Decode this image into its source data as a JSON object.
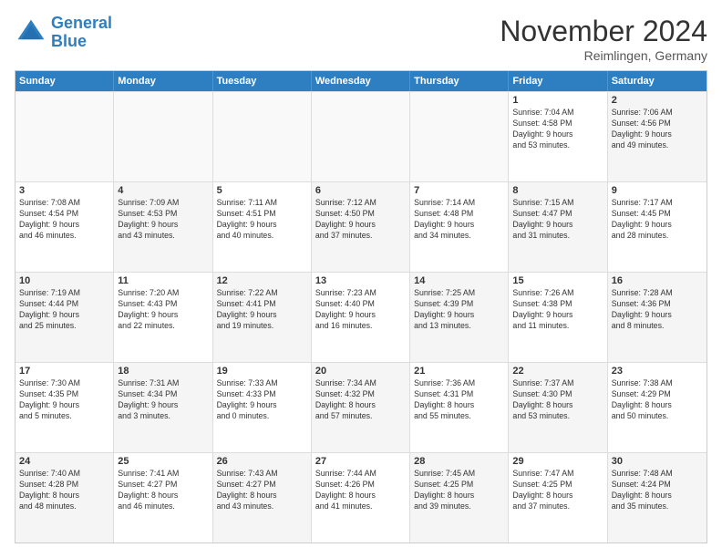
{
  "header": {
    "logo_general": "General",
    "logo_blue": "Blue",
    "month_title": "November 2024",
    "location": "Reimlingen, Germany"
  },
  "weekdays": [
    "Sunday",
    "Monday",
    "Tuesday",
    "Wednesday",
    "Thursday",
    "Friday",
    "Saturday"
  ],
  "weeks": [
    [
      {
        "day": "",
        "info": "",
        "empty": true
      },
      {
        "day": "",
        "info": "",
        "empty": true
      },
      {
        "day": "",
        "info": "",
        "empty": true
      },
      {
        "day": "",
        "info": "",
        "empty": true
      },
      {
        "day": "",
        "info": "",
        "empty": true
      },
      {
        "day": "1",
        "info": "Sunrise: 7:04 AM\nSunset: 4:58 PM\nDaylight: 9 hours\nand 53 minutes.",
        "empty": false
      },
      {
        "day": "2",
        "info": "Sunrise: 7:06 AM\nSunset: 4:56 PM\nDaylight: 9 hours\nand 49 minutes.",
        "empty": false,
        "shaded": true
      }
    ],
    [
      {
        "day": "3",
        "info": "Sunrise: 7:08 AM\nSunset: 4:54 PM\nDaylight: 9 hours\nand 46 minutes.",
        "empty": false
      },
      {
        "day": "4",
        "info": "Sunrise: 7:09 AM\nSunset: 4:53 PM\nDaylight: 9 hours\nand 43 minutes.",
        "empty": false,
        "shaded": true
      },
      {
        "day": "5",
        "info": "Sunrise: 7:11 AM\nSunset: 4:51 PM\nDaylight: 9 hours\nand 40 minutes.",
        "empty": false
      },
      {
        "day": "6",
        "info": "Sunrise: 7:12 AM\nSunset: 4:50 PM\nDaylight: 9 hours\nand 37 minutes.",
        "empty": false,
        "shaded": true
      },
      {
        "day": "7",
        "info": "Sunrise: 7:14 AM\nSunset: 4:48 PM\nDaylight: 9 hours\nand 34 minutes.",
        "empty": false
      },
      {
        "day": "8",
        "info": "Sunrise: 7:15 AM\nSunset: 4:47 PM\nDaylight: 9 hours\nand 31 minutes.",
        "empty": false,
        "shaded": true
      },
      {
        "day": "9",
        "info": "Sunrise: 7:17 AM\nSunset: 4:45 PM\nDaylight: 9 hours\nand 28 minutes.",
        "empty": false
      }
    ],
    [
      {
        "day": "10",
        "info": "Sunrise: 7:19 AM\nSunset: 4:44 PM\nDaylight: 9 hours\nand 25 minutes.",
        "empty": false,
        "shaded": true
      },
      {
        "day": "11",
        "info": "Sunrise: 7:20 AM\nSunset: 4:43 PM\nDaylight: 9 hours\nand 22 minutes.",
        "empty": false
      },
      {
        "day": "12",
        "info": "Sunrise: 7:22 AM\nSunset: 4:41 PM\nDaylight: 9 hours\nand 19 minutes.",
        "empty": false,
        "shaded": true
      },
      {
        "day": "13",
        "info": "Sunrise: 7:23 AM\nSunset: 4:40 PM\nDaylight: 9 hours\nand 16 minutes.",
        "empty": false
      },
      {
        "day": "14",
        "info": "Sunrise: 7:25 AM\nSunset: 4:39 PM\nDaylight: 9 hours\nand 13 minutes.",
        "empty": false,
        "shaded": true
      },
      {
        "day": "15",
        "info": "Sunrise: 7:26 AM\nSunset: 4:38 PM\nDaylight: 9 hours\nand 11 minutes.",
        "empty": false
      },
      {
        "day": "16",
        "info": "Sunrise: 7:28 AM\nSunset: 4:36 PM\nDaylight: 9 hours\nand 8 minutes.",
        "empty": false,
        "shaded": true
      }
    ],
    [
      {
        "day": "17",
        "info": "Sunrise: 7:30 AM\nSunset: 4:35 PM\nDaylight: 9 hours\nand 5 minutes.",
        "empty": false
      },
      {
        "day": "18",
        "info": "Sunrise: 7:31 AM\nSunset: 4:34 PM\nDaylight: 9 hours\nand 3 minutes.",
        "empty": false,
        "shaded": true
      },
      {
        "day": "19",
        "info": "Sunrise: 7:33 AM\nSunset: 4:33 PM\nDaylight: 9 hours\nand 0 minutes.",
        "empty": false
      },
      {
        "day": "20",
        "info": "Sunrise: 7:34 AM\nSunset: 4:32 PM\nDaylight: 8 hours\nand 57 minutes.",
        "empty": false,
        "shaded": true
      },
      {
        "day": "21",
        "info": "Sunrise: 7:36 AM\nSunset: 4:31 PM\nDaylight: 8 hours\nand 55 minutes.",
        "empty": false
      },
      {
        "day": "22",
        "info": "Sunrise: 7:37 AM\nSunset: 4:30 PM\nDaylight: 8 hours\nand 53 minutes.",
        "empty": false,
        "shaded": true
      },
      {
        "day": "23",
        "info": "Sunrise: 7:38 AM\nSunset: 4:29 PM\nDaylight: 8 hours\nand 50 minutes.",
        "empty": false
      }
    ],
    [
      {
        "day": "24",
        "info": "Sunrise: 7:40 AM\nSunset: 4:28 PM\nDaylight: 8 hours\nand 48 minutes.",
        "empty": false,
        "shaded": true
      },
      {
        "day": "25",
        "info": "Sunrise: 7:41 AM\nSunset: 4:27 PM\nDaylight: 8 hours\nand 46 minutes.",
        "empty": false
      },
      {
        "day": "26",
        "info": "Sunrise: 7:43 AM\nSunset: 4:27 PM\nDaylight: 8 hours\nand 43 minutes.",
        "empty": false,
        "shaded": true
      },
      {
        "day": "27",
        "info": "Sunrise: 7:44 AM\nSunset: 4:26 PM\nDaylight: 8 hours\nand 41 minutes.",
        "empty": false
      },
      {
        "day": "28",
        "info": "Sunrise: 7:45 AM\nSunset: 4:25 PM\nDaylight: 8 hours\nand 39 minutes.",
        "empty": false,
        "shaded": true
      },
      {
        "day": "29",
        "info": "Sunrise: 7:47 AM\nSunset: 4:25 PM\nDaylight: 8 hours\nand 37 minutes.",
        "empty": false
      },
      {
        "day": "30",
        "info": "Sunrise: 7:48 AM\nSunset: 4:24 PM\nDaylight: 8 hours\nand 35 minutes.",
        "empty": false,
        "shaded": true
      }
    ]
  ]
}
